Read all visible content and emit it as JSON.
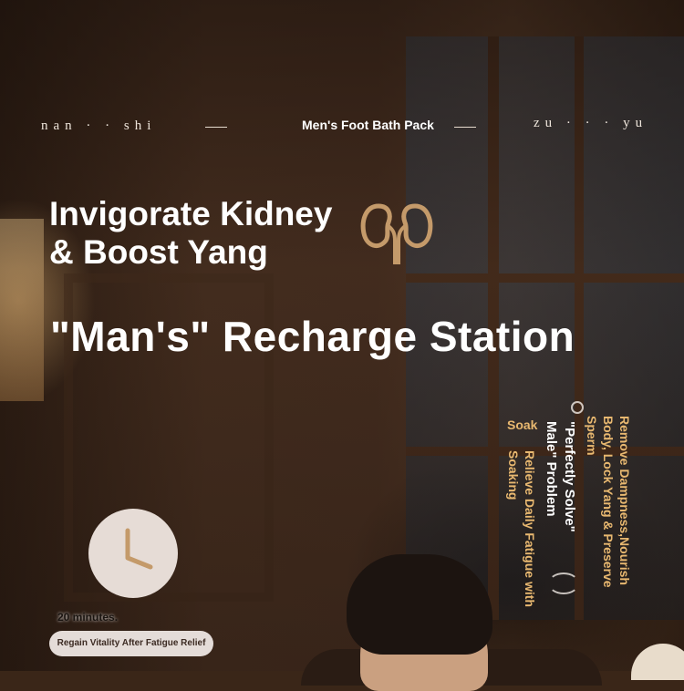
{
  "top_bar": {
    "left_text": "nan · · shi",
    "pack_title": "Men's Foot Bath Pack",
    "right_text": "zu · · · yu"
  },
  "headline": {
    "line1": "Invigorate Kidney",
    "line2": "& Boost Yang"
  },
  "main_title": "\"Man's\" Recharge Station",
  "vertical_text": {
    "col1": "Remove Dampness,Nourish",
    "col2": "Body, Lock Yang & Preserve",
    "col3": "Sperm",
    "col4": "\"Perfectly Solve\"",
    "col5": "Male\" Problem",
    "col6": "Soak",
    "col7": "Relieve Daily Fatigue with",
    "col8": "Soaking"
  },
  "timer": {
    "minutes_label": "20 minutes."
  },
  "pill": {
    "label": "Regain Vitality After Fatigue Relief"
  },
  "colors": {
    "accent_gold": "#e8b870",
    "kidney_icon": "#c49a6a",
    "clock_hand": "#c49a6a"
  },
  "icons": [
    "kidney-icon",
    "clock-icon"
  ]
}
